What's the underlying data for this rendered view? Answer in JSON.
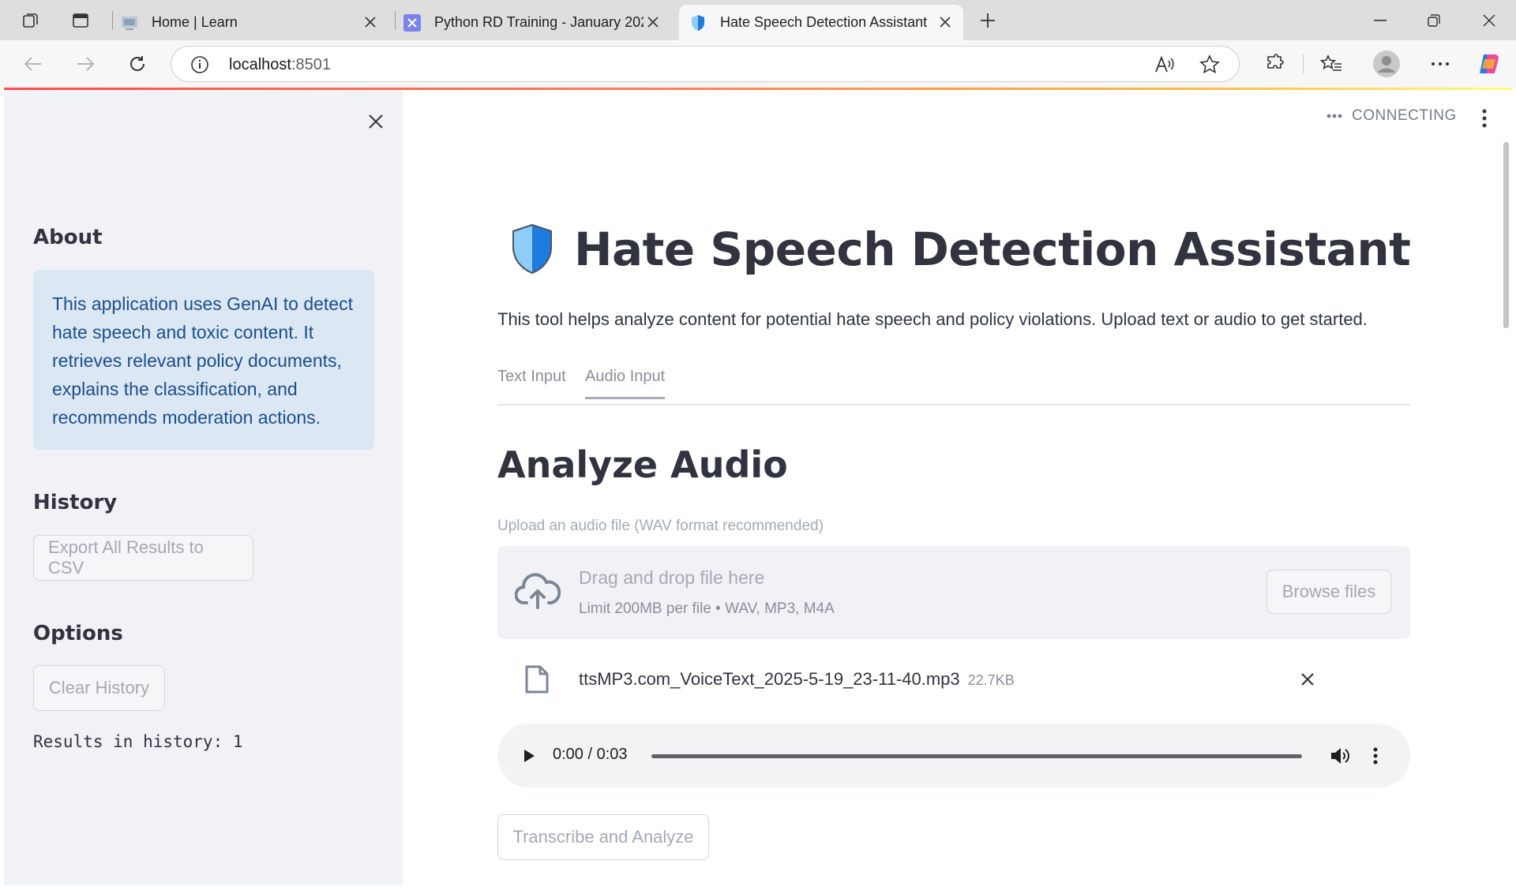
{
  "browser": {
    "tabs": [
      {
        "title": "Home | Learn"
      },
      {
        "title": "Python RD Training - January 202"
      },
      {
        "title": "Hate Speech Detection Assistant"
      }
    ],
    "url_host": "localhost",
    "url_port": ":8501"
  },
  "sidebar": {
    "about_heading": "About",
    "about_text": "This application uses GenAI to detect hate speech and toxic content. It retrieves relevant policy documents, explains the classification, and recommends moderation actions.",
    "history_heading": "History",
    "export_button": "Export All Results to CSV",
    "options_heading": "Options",
    "clear_button": "Clear History",
    "results_count": "Results in history: 1"
  },
  "main": {
    "status": "CONNECTING",
    "title": "Hate Speech Detection Assistant",
    "subtitle": "This tool helps analyze content for potential hate speech and policy violations. Upload text or audio to get started.",
    "tabs": [
      {
        "label": "Text Input"
      },
      {
        "label": "Audio Input"
      }
    ],
    "active_tab": "Audio Input",
    "section_heading": "Analyze Audio",
    "uploader_label": "Upload an audio file (WAV format recommended)",
    "dropzone_text": "Drag and drop file here",
    "dropzone_limit": "Limit 200MB per file • WAV, MP3, M4A",
    "browse_button": "Browse files",
    "file": {
      "name": "ttsMP3.com_VoiceText_2025-5-19_23-11-40.mp3",
      "size": "22.7KB"
    },
    "player": {
      "time": "0:00 / 0:03",
      "progress": 0
    },
    "analyze_button": "Transcribe and Analyze"
  },
  "colors": {
    "sidebar_bg": "#f0f2f6",
    "info_bg": "#dce7f4",
    "info_text": "#1c4f8a",
    "shield_light": "#8ecdf7",
    "shield_dark": "#1e7be0"
  }
}
